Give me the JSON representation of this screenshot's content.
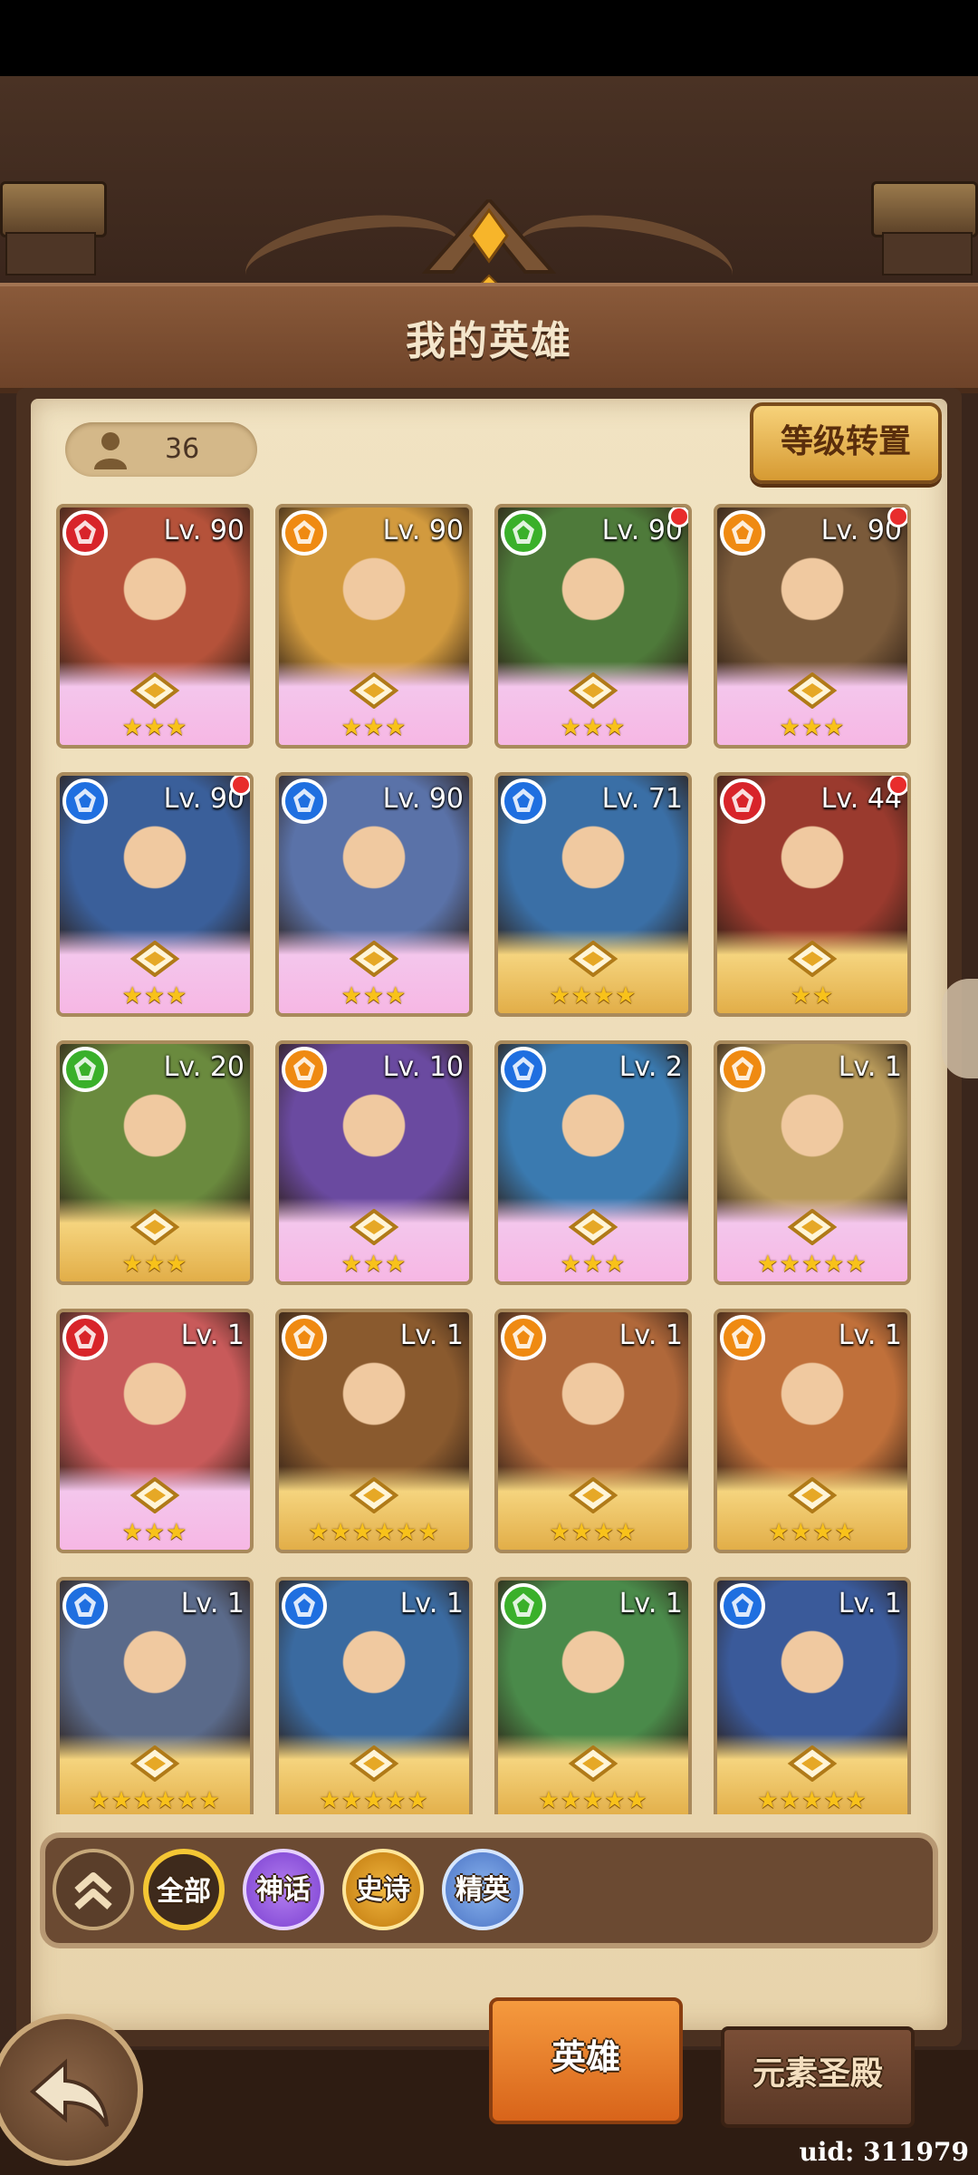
{
  "title": "我的英雄",
  "hero_count": "36",
  "level_transfer_label": "等级转置",
  "element_colors": {
    "fire": "#d8242a",
    "light": "#ef8a12",
    "nature": "#3ab02a",
    "water": "#1f6fe0"
  },
  "heroes": [
    {
      "level": "Lv. 90",
      "element": "fire",
      "stars": "★★★",
      "frame": "pink",
      "new": false,
      "art": "#b5523a"
    },
    {
      "level": "Lv. 90",
      "element": "light",
      "stars": "★★★",
      "frame": "pink",
      "new": false,
      "art": "#d29a3e"
    },
    {
      "level": "Lv. 90",
      "element": "nature",
      "stars": "★★★",
      "frame": "pink",
      "new": true,
      "art": "#4e7a3a"
    },
    {
      "level": "Lv. 90",
      "element": "light",
      "stars": "★★★",
      "frame": "pink",
      "new": true,
      "art": "#7a5a3a"
    },
    {
      "level": "Lv. 90",
      "element": "water",
      "stars": "★★★",
      "frame": "pink",
      "new": true,
      "art": "#3a5f9a"
    },
    {
      "level": "Lv. 90",
      "element": "water",
      "stars": "★★★",
      "frame": "pink",
      "new": false,
      "art": "#5a72a8"
    },
    {
      "level": "Lv. 71",
      "element": "water",
      "stars": "★★★★",
      "frame": "gold",
      "new": false,
      "art": "#3a6fa6"
    },
    {
      "level": "Lv. 44",
      "element": "fire",
      "stars": "★★",
      "frame": "gold",
      "new": true,
      "art": "#9a3a2e"
    },
    {
      "level": "Lv. 20",
      "element": "nature",
      "stars": "★★★",
      "frame": "gold",
      "new": false,
      "art": "#6a8a3e"
    },
    {
      "level": "Lv. 10",
      "element": "light",
      "stars": "★★★",
      "frame": "pink",
      "new": false,
      "art": "#6a4aa0"
    },
    {
      "level": "Lv. 2",
      "element": "water",
      "stars": "★★★",
      "frame": "pink",
      "new": false,
      "art": "#3a7ab0"
    },
    {
      "level": "Lv. 1",
      "element": "light",
      "stars": "★★★★★",
      "frame": "pink",
      "new": false,
      "art": "#b89a5a"
    },
    {
      "level": "Lv. 1",
      "element": "fire",
      "stars": "★★★",
      "frame": "pink",
      "new": false,
      "art": "#c85a5a"
    },
    {
      "level": "Lv. 1",
      "element": "light",
      "stars": "★★★★★★",
      "frame": "gold",
      "new": false,
      "art": "#8a5a2e"
    },
    {
      "level": "Lv. 1",
      "element": "light",
      "stars": "★★★★",
      "frame": "gold",
      "new": false,
      "art": "#b0683a"
    },
    {
      "level": "Lv. 1",
      "element": "light",
      "stars": "★★★★",
      "frame": "gold",
      "new": false,
      "art": "#c0703a"
    },
    {
      "level": "Lv. 1",
      "element": "water",
      "stars": "★★★★★★",
      "frame": "gold",
      "new": false,
      "art": "#5a6a8a"
    },
    {
      "level": "Lv. 1",
      "element": "water",
      "stars": "★★★★★",
      "frame": "gold",
      "new": false,
      "art": "#3a6aa0"
    },
    {
      "level": "Lv. 1",
      "element": "nature",
      "stars": "★★★★★",
      "frame": "gold",
      "new": false,
      "art": "#4a8a4a"
    },
    {
      "level": "Lv. 1",
      "element": "water",
      "stars": "★★★★★",
      "frame": "gold",
      "new": false,
      "art": "#3a5a9a"
    }
  ],
  "filters": {
    "all": "全部",
    "mythic": "神话",
    "epic": "史诗",
    "elite": "精英"
  },
  "tabs": {
    "heroes": "英雄",
    "temple": "元素圣殿"
  },
  "uid": "uid: 311979"
}
